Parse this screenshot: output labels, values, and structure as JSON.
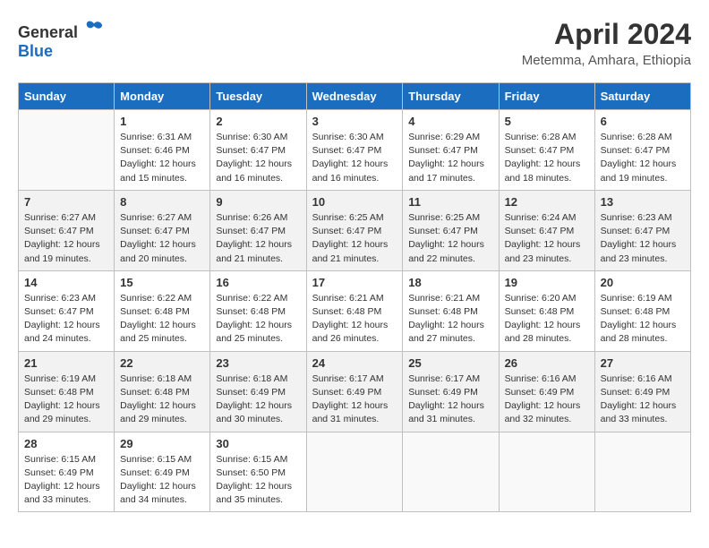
{
  "header": {
    "logo_general": "General",
    "logo_blue": "Blue",
    "month_year": "April 2024",
    "location": "Metemma, Amhara, Ethiopia"
  },
  "days_of_week": [
    "Sunday",
    "Monday",
    "Tuesday",
    "Wednesday",
    "Thursday",
    "Friday",
    "Saturday"
  ],
  "weeks": [
    [
      {
        "day": "",
        "info": ""
      },
      {
        "day": "1",
        "info": "Sunrise: 6:31 AM\nSunset: 6:46 PM\nDaylight: 12 hours\nand 15 minutes."
      },
      {
        "day": "2",
        "info": "Sunrise: 6:30 AM\nSunset: 6:47 PM\nDaylight: 12 hours\nand 16 minutes."
      },
      {
        "day": "3",
        "info": "Sunrise: 6:30 AM\nSunset: 6:47 PM\nDaylight: 12 hours\nand 16 minutes."
      },
      {
        "day": "4",
        "info": "Sunrise: 6:29 AM\nSunset: 6:47 PM\nDaylight: 12 hours\nand 17 minutes."
      },
      {
        "day": "5",
        "info": "Sunrise: 6:28 AM\nSunset: 6:47 PM\nDaylight: 12 hours\nand 18 minutes."
      },
      {
        "day": "6",
        "info": "Sunrise: 6:28 AM\nSunset: 6:47 PM\nDaylight: 12 hours\nand 19 minutes."
      }
    ],
    [
      {
        "day": "7",
        "info": "Sunrise: 6:27 AM\nSunset: 6:47 PM\nDaylight: 12 hours\nand 19 minutes."
      },
      {
        "day": "8",
        "info": "Sunrise: 6:27 AM\nSunset: 6:47 PM\nDaylight: 12 hours\nand 20 minutes."
      },
      {
        "day": "9",
        "info": "Sunrise: 6:26 AM\nSunset: 6:47 PM\nDaylight: 12 hours\nand 21 minutes."
      },
      {
        "day": "10",
        "info": "Sunrise: 6:25 AM\nSunset: 6:47 PM\nDaylight: 12 hours\nand 21 minutes."
      },
      {
        "day": "11",
        "info": "Sunrise: 6:25 AM\nSunset: 6:47 PM\nDaylight: 12 hours\nand 22 minutes."
      },
      {
        "day": "12",
        "info": "Sunrise: 6:24 AM\nSunset: 6:47 PM\nDaylight: 12 hours\nand 23 minutes."
      },
      {
        "day": "13",
        "info": "Sunrise: 6:23 AM\nSunset: 6:47 PM\nDaylight: 12 hours\nand 23 minutes."
      }
    ],
    [
      {
        "day": "14",
        "info": "Sunrise: 6:23 AM\nSunset: 6:47 PM\nDaylight: 12 hours\nand 24 minutes."
      },
      {
        "day": "15",
        "info": "Sunrise: 6:22 AM\nSunset: 6:48 PM\nDaylight: 12 hours\nand 25 minutes."
      },
      {
        "day": "16",
        "info": "Sunrise: 6:22 AM\nSunset: 6:48 PM\nDaylight: 12 hours\nand 25 minutes."
      },
      {
        "day": "17",
        "info": "Sunrise: 6:21 AM\nSunset: 6:48 PM\nDaylight: 12 hours\nand 26 minutes."
      },
      {
        "day": "18",
        "info": "Sunrise: 6:21 AM\nSunset: 6:48 PM\nDaylight: 12 hours\nand 27 minutes."
      },
      {
        "day": "19",
        "info": "Sunrise: 6:20 AM\nSunset: 6:48 PM\nDaylight: 12 hours\nand 28 minutes."
      },
      {
        "day": "20",
        "info": "Sunrise: 6:19 AM\nSunset: 6:48 PM\nDaylight: 12 hours\nand 28 minutes."
      }
    ],
    [
      {
        "day": "21",
        "info": "Sunrise: 6:19 AM\nSunset: 6:48 PM\nDaylight: 12 hours\nand 29 minutes."
      },
      {
        "day": "22",
        "info": "Sunrise: 6:18 AM\nSunset: 6:48 PM\nDaylight: 12 hours\nand 29 minutes."
      },
      {
        "day": "23",
        "info": "Sunrise: 6:18 AM\nSunset: 6:49 PM\nDaylight: 12 hours\nand 30 minutes."
      },
      {
        "day": "24",
        "info": "Sunrise: 6:17 AM\nSunset: 6:49 PM\nDaylight: 12 hours\nand 31 minutes."
      },
      {
        "day": "25",
        "info": "Sunrise: 6:17 AM\nSunset: 6:49 PM\nDaylight: 12 hours\nand 31 minutes."
      },
      {
        "day": "26",
        "info": "Sunrise: 6:16 AM\nSunset: 6:49 PM\nDaylight: 12 hours\nand 32 minutes."
      },
      {
        "day": "27",
        "info": "Sunrise: 6:16 AM\nSunset: 6:49 PM\nDaylight: 12 hours\nand 33 minutes."
      }
    ],
    [
      {
        "day": "28",
        "info": "Sunrise: 6:15 AM\nSunset: 6:49 PM\nDaylight: 12 hours\nand 33 minutes."
      },
      {
        "day": "29",
        "info": "Sunrise: 6:15 AM\nSunset: 6:49 PM\nDaylight: 12 hours\nand 34 minutes."
      },
      {
        "day": "30",
        "info": "Sunrise: 6:15 AM\nSunset: 6:50 PM\nDaylight: 12 hours\nand 35 minutes."
      },
      {
        "day": "",
        "info": ""
      },
      {
        "day": "",
        "info": ""
      },
      {
        "day": "",
        "info": ""
      },
      {
        "day": "",
        "info": ""
      }
    ]
  ]
}
